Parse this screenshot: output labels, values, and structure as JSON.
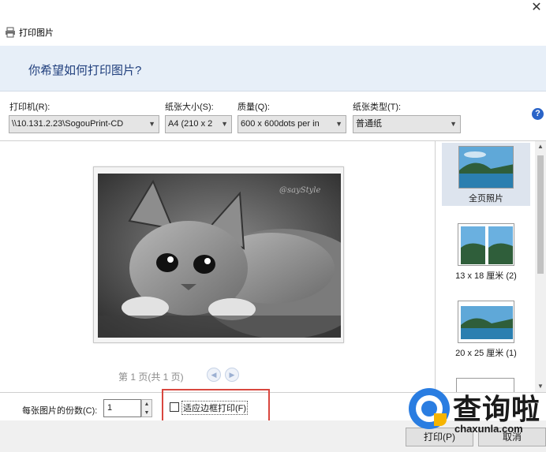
{
  "window": {
    "title": "打印图片",
    "close_glyph": "✕"
  },
  "banner": {
    "question": "你希望如何打印图片?"
  },
  "options": {
    "printer_label": "打印机(R):",
    "printer_value": "\\\\10.131.2.23\\SogouPrint-CD",
    "paper_size_label": "纸张大小(S):",
    "paper_size_value": "A4 (210 x 2",
    "quality_label": "质量(Q):",
    "quality_value": "600 x 600dots per in",
    "paper_type_label": "纸张类型(T):",
    "paper_type_value": "普通纸",
    "help_glyph": "?"
  },
  "preview": {
    "page_info": "第 1 页(共 1 页)",
    "watermark_text": "@sayStyle"
  },
  "layouts": [
    {
      "label": "全页照片",
      "selected": true
    },
    {
      "label": "13 x 18 厘米 (2)",
      "selected": false
    },
    {
      "label": "20 x 25 厘米 (1)",
      "selected": false
    }
  ],
  "bottom": {
    "copies_label": "每张图片的份数(C):",
    "copies_value": "1",
    "fit_label": "适应边框打印(F)",
    "fit_checked": false
  },
  "buttons": {
    "print": "打印(P)",
    "cancel": "取消"
  },
  "logo": {
    "text": "查询啦",
    "url": "chaxunla.com"
  },
  "colors": {
    "banner_bg": "#e7eff8",
    "question_text": "#1f3e7c",
    "highlight_border": "#d9473f",
    "help_icon": "#2a64c8"
  }
}
